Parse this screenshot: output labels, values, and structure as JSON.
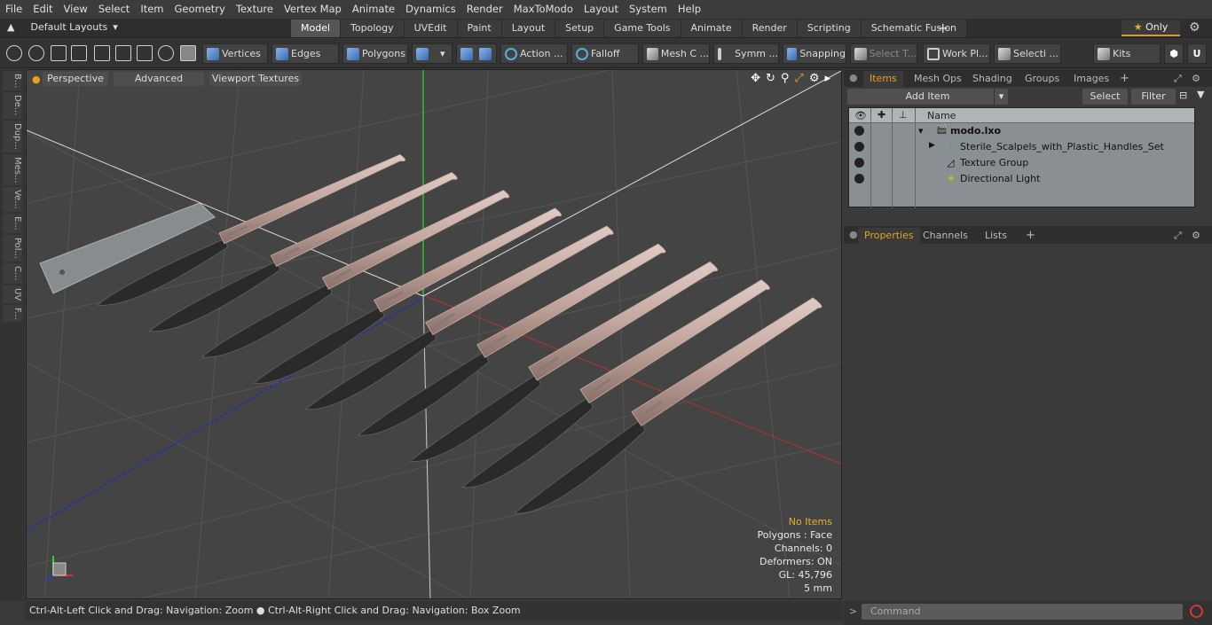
{
  "menu": [
    "File",
    "Edit",
    "View",
    "Select",
    "Item",
    "Geometry",
    "Texture",
    "Vertex Map",
    "Animate",
    "Dynamics",
    "Render",
    "MaxToModo",
    "Layout",
    "System",
    "Help"
  ],
  "layout_dropdown": "Default Layouts",
  "tabs": [
    {
      "label": "Model",
      "active": true
    },
    {
      "label": "Topology"
    },
    {
      "label": "UVEdit"
    },
    {
      "label": "Paint"
    },
    {
      "label": "Layout"
    },
    {
      "label": "Setup"
    },
    {
      "label": "Game Tools"
    },
    {
      "label": "Animate"
    },
    {
      "label": "Render"
    },
    {
      "label": "Scripting"
    },
    {
      "label": "Schematic Fusion"
    }
  ],
  "only_label": "Only",
  "toolbar": {
    "vertices": "Vertices",
    "edges": "Edges",
    "polygons": "Polygons",
    "action": "Action ...",
    "falloff": "Falloff",
    "mesh_c": "Mesh C ...",
    "symm": "Symm ...",
    "snapping": "Snapping",
    "select_t": "Select T...",
    "work_pl": "Work Pl...",
    "selecti": "Selecti ...",
    "kits": "Kits"
  },
  "left_tabs": [
    "B...",
    "De...",
    "Dup...",
    "Mes...",
    "Ve...",
    "E...",
    "Pol...",
    "C...",
    "UV",
    "F..."
  ],
  "viewport": {
    "perspective": "Perspective",
    "advanced": "Advanced",
    "viewport_textures": "Viewport Textures",
    "info": {
      "no_items": "No Items",
      "polygons": "Polygons : Face",
      "channels": "Channels: 0",
      "deformers": "Deformers: ON",
      "gl": "GL: 45,796",
      "scale": "5 mm"
    }
  },
  "status": "Ctrl-Alt-Left Click and Drag: Navigation: Zoom ● Ctrl-Alt-Right Click and Drag: Navigation: Box Zoom",
  "items_panel": {
    "tabs": [
      "Items",
      "Mesh Ops",
      "Shading",
      "Groups",
      "Images"
    ],
    "add_item": "Add Item",
    "select": "Select",
    "filter": "Filter",
    "name_header": "Name",
    "tree": [
      {
        "label": "modo.lxo"
      },
      {
        "label": "Sterile_Scalpels_with_Plastic_Handles_Set"
      },
      {
        "label": "Texture Group"
      },
      {
        "label": "Directional Light"
      }
    ]
  },
  "props_panel": {
    "tabs": [
      "Properties",
      "Channels",
      "Lists"
    ]
  },
  "command_placeholder": "Command",
  "colors": {
    "accent": "#e8a020",
    "handle": "#c9aea6",
    "blade": "#2a2a2a"
  }
}
